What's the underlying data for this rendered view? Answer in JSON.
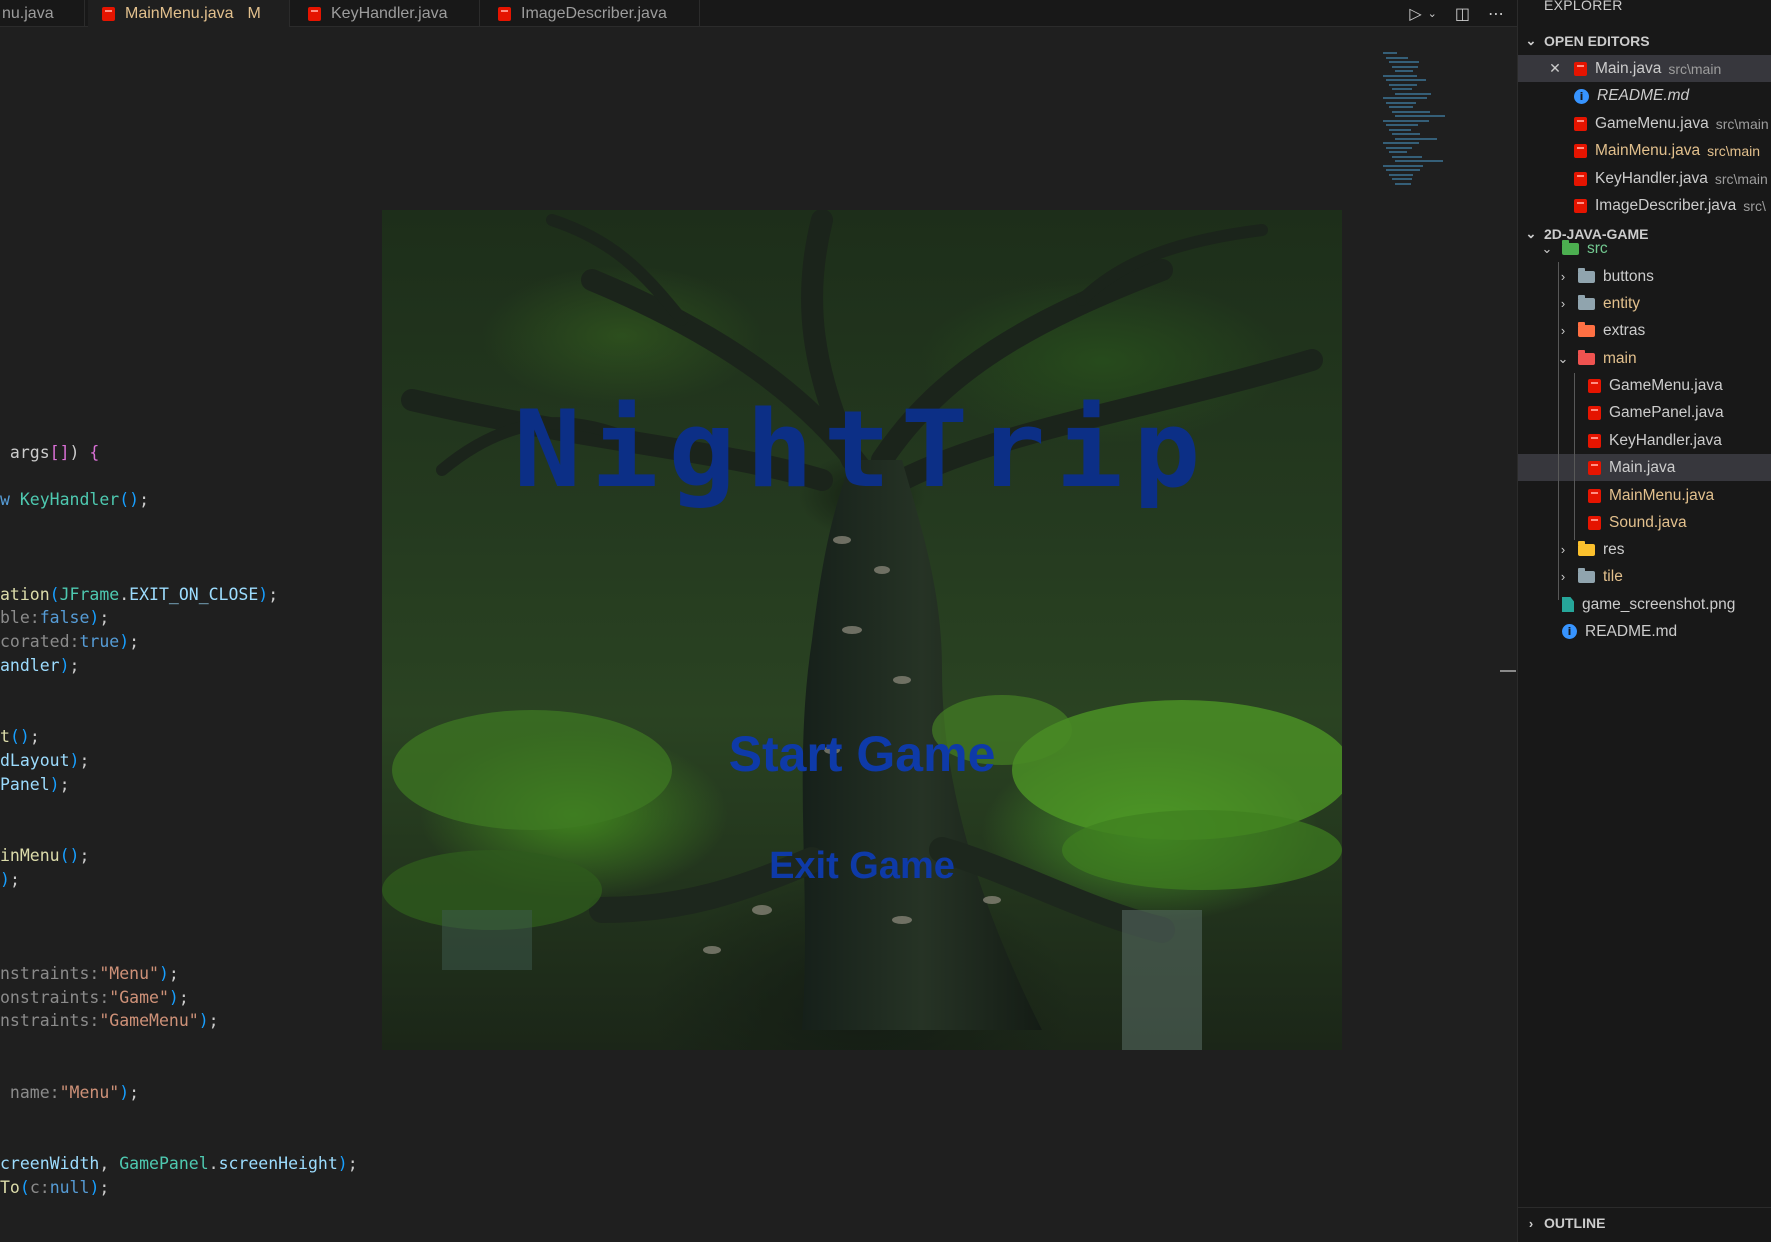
{
  "tabs": [
    {
      "label": "nu.java",
      "active": false,
      "modified": false
    },
    {
      "label": "MainMenu.java",
      "active": true,
      "modified": true,
      "badge": "M"
    },
    {
      "label": "KeyHandler.java",
      "active": false,
      "modified": false
    },
    {
      "label": "ImageDescriber.java",
      "active": false,
      "modified": false
    }
  ],
  "tab_actions": {
    "run_icon": "play-icon",
    "split_icon": "split-editor-icon",
    "more_icon": "ellipsis-icon"
  },
  "code_lines": [
    {
      "parts": [
        {
          "c": "",
          "t": " args"
        },
        {
          "c": "p",
          "t": "[]"
        },
        {
          "c": "",
          "t": ") "
        },
        {
          "c": "p",
          "t": "{"
        }
      ]
    },
    {
      "parts": [
        {
          "c": "k",
          "t": "w"
        },
        {
          "c": "",
          "t": " "
        },
        {
          "c": "t",
          "t": "KeyHandler"
        },
        {
          "c": "b",
          "t": "()"
        },
        {
          "c": "",
          "t": ";"
        }
      ]
    },
    {
      "parts": [
        {
          "c": "f",
          "t": "ation"
        },
        {
          "c": "b",
          "t": "("
        },
        {
          "c": "t",
          "t": "JFrame"
        },
        {
          "c": "",
          "t": "."
        },
        {
          "c": "v",
          "t": "EXIT_ON_CLOSE"
        },
        {
          "c": "b",
          "t": ")"
        },
        {
          "c": "",
          "t": ";"
        }
      ]
    },
    {
      "parts": [
        {
          "c": "h",
          "t": "ble:"
        },
        {
          "c": "k",
          "t": "false"
        },
        {
          "c": "b",
          "t": ")"
        },
        {
          "c": "",
          "t": ";"
        }
      ]
    },
    {
      "parts": [
        {
          "c": "h",
          "t": "corated:"
        },
        {
          "c": "k",
          "t": "true"
        },
        {
          "c": "b",
          "t": ")"
        },
        {
          "c": "",
          "t": ";"
        }
      ]
    },
    {
      "parts": [
        {
          "c": "v",
          "t": "andler"
        },
        {
          "c": "b",
          "t": ")"
        },
        {
          "c": "",
          "t": ";"
        }
      ]
    },
    {
      "parts": [
        {
          "c": "f",
          "t": "t"
        },
        {
          "c": "b",
          "t": "()"
        },
        {
          "c": "",
          "t": ";"
        }
      ]
    },
    {
      "parts": [
        {
          "c": "v",
          "t": "dLayout"
        },
        {
          "c": "b",
          "t": ")"
        },
        {
          "c": "",
          "t": ";"
        }
      ]
    },
    {
      "parts": [
        {
          "c": "v",
          "t": "Panel"
        },
        {
          "c": "b",
          "t": ")"
        },
        {
          "c": "",
          "t": ";"
        }
      ]
    },
    {
      "parts": [
        {
          "c": "f",
          "t": "inMenu"
        },
        {
          "c": "b",
          "t": "()"
        },
        {
          "c": "",
          "t": ";"
        }
      ]
    },
    {
      "parts": [
        {
          "c": "b",
          "t": ")"
        },
        {
          "c": "",
          "t": ";"
        }
      ]
    },
    {
      "parts": [
        {
          "c": "h",
          "t": "nstraints:"
        },
        {
          "c": "s",
          "t": "\"Menu\""
        },
        {
          "c": "b",
          "t": ")"
        },
        {
          "c": "",
          "t": ";"
        }
      ]
    },
    {
      "parts": [
        {
          "c": "h",
          "t": "onstraints:"
        },
        {
          "c": "s",
          "t": "\"Game\""
        },
        {
          "c": "b",
          "t": ")"
        },
        {
          "c": "",
          "t": ";"
        }
      ]
    },
    {
      "parts": [
        {
          "c": "h",
          "t": "nstraints:"
        },
        {
          "c": "s",
          "t": "\"GameMenu\""
        },
        {
          "c": "b",
          "t": ")"
        },
        {
          "c": "",
          "t": ";"
        }
      ]
    },
    {
      "parts": [
        {
          "c": "h",
          "t": " name:"
        },
        {
          "c": "s",
          "t": "\"Menu\""
        },
        {
          "c": "b",
          "t": ")"
        },
        {
          "c": "",
          "t": ";"
        }
      ]
    },
    {
      "parts": [
        {
          "c": "v",
          "t": "creenWidth"
        },
        {
          "c": "",
          "t": ", "
        },
        {
          "c": "t",
          "t": "GamePanel"
        },
        {
          "c": "",
          "t": "."
        },
        {
          "c": "v",
          "t": "screenHeight"
        },
        {
          "c": "b",
          "t": ")"
        },
        {
          "c": "",
          "t": ";"
        }
      ]
    },
    {
      "parts": [
        {
          "c": "f",
          "t": "To"
        },
        {
          "c": "b",
          "t": "("
        },
        {
          "c": "h",
          "t": "c:"
        },
        {
          "c": "k",
          "t": "null"
        },
        {
          "c": "b",
          "t": ")"
        },
        {
          "c": "",
          "t": ";"
        }
      ]
    }
  ],
  "game": {
    "title": "NightTrip",
    "start_label": "Start Game",
    "exit_label": "Exit Game"
  },
  "explorer": {
    "title": "EXPLORER",
    "open_editors_header": "OPEN EDITORS",
    "open_editors": [
      {
        "name": "Main.java",
        "desc": "src\\main",
        "icon": "java-icon",
        "selected": true,
        "closable": true
      },
      {
        "name": "README.md",
        "desc": "",
        "icon": "info-icon",
        "italic": true
      },
      {
        "name": "GameMenu.java",
        "desc": "src\\main",
        "icon": "java-icon"
      },
      {
        "name": "MainMenu.java",
        "desc": "src\\main",
        "icon": "java-icon",
        "modified": true
      },
      {
        "name": "KeyHandler.java",
        "desc": "src\\main",
        "icon": "java-icon"
      },
      {
        "name": "ImageDescriber.java",
        "desc": "src\\",
        "icon": "java-icon"
      }
    ],
    "project_header": "2D-JAVA-GAME",
    "tree": [
      {
        "name": "src",
        "type": "folder-open",
        "depth": 0,
        "color": "#4caf50",
        "label_color": "#73c991"
      },
      {
        "name": "buttons",
        "type": "folder",
        "depth": 1,
        "color": "#90a4ae"
      },
      {
        "name": "entity",
        "type": "folder",
        "depth": 1,
        "color": "#90a4ae",
        "modified": true
      },
      {
        "name": "extras",
        "type": "folder",
        "depth": 1,
        "color": "#ff7043"
      },
      {
        "name": "main",
        "type": "folder-open",
        "depth": 1,
        "color": "#ef5350",
        "modified": true
      },
      {
        "name": "GameMenu.java",
        "type": "java",
        "depth": 2
      },
      {
        "name": "GamePanel.java",
        "type": "java",
        "depth": 2
      },
      {
        "name": "KeyHandler.java",
        "type": "java",
        "depth": 2
      },
      {
        "name": "Main.java",
        "type": "java",
        "depth": 2,
        "selected": true
      },
      {
        "name": "MainMenu.java",
        "type": "java",
        "depth": 2,
        "modified": true
      },
      {
        "name": "Sound.java",
        "type": "java",
        "depth": 2,
        "modified": true
      },
      {
        "name": "res",
        "type": "folder",
        "depth": 1,
        "color": "#fbc02d"
      },
      {
        "name": "tile",
        "type": "folder",
        "depth": 1,
        "color": "#90a4ae",
        "modified": true
      },
      {
        "name": "game_screenshot.png",
        "type": "image",
        "depth": 0
      },
      {
        "name": "README.md",
        "type": "info",
        "depth": 0
      }
    ],
    "outline_header": "OUTLINE"
  },
  "colors": {
    "modified": "#e2c08d",
    "java_icon": "#e51400",
    "game_title": "#0c2f86",
    "game_button": "#0e3aa8"
  }
}
